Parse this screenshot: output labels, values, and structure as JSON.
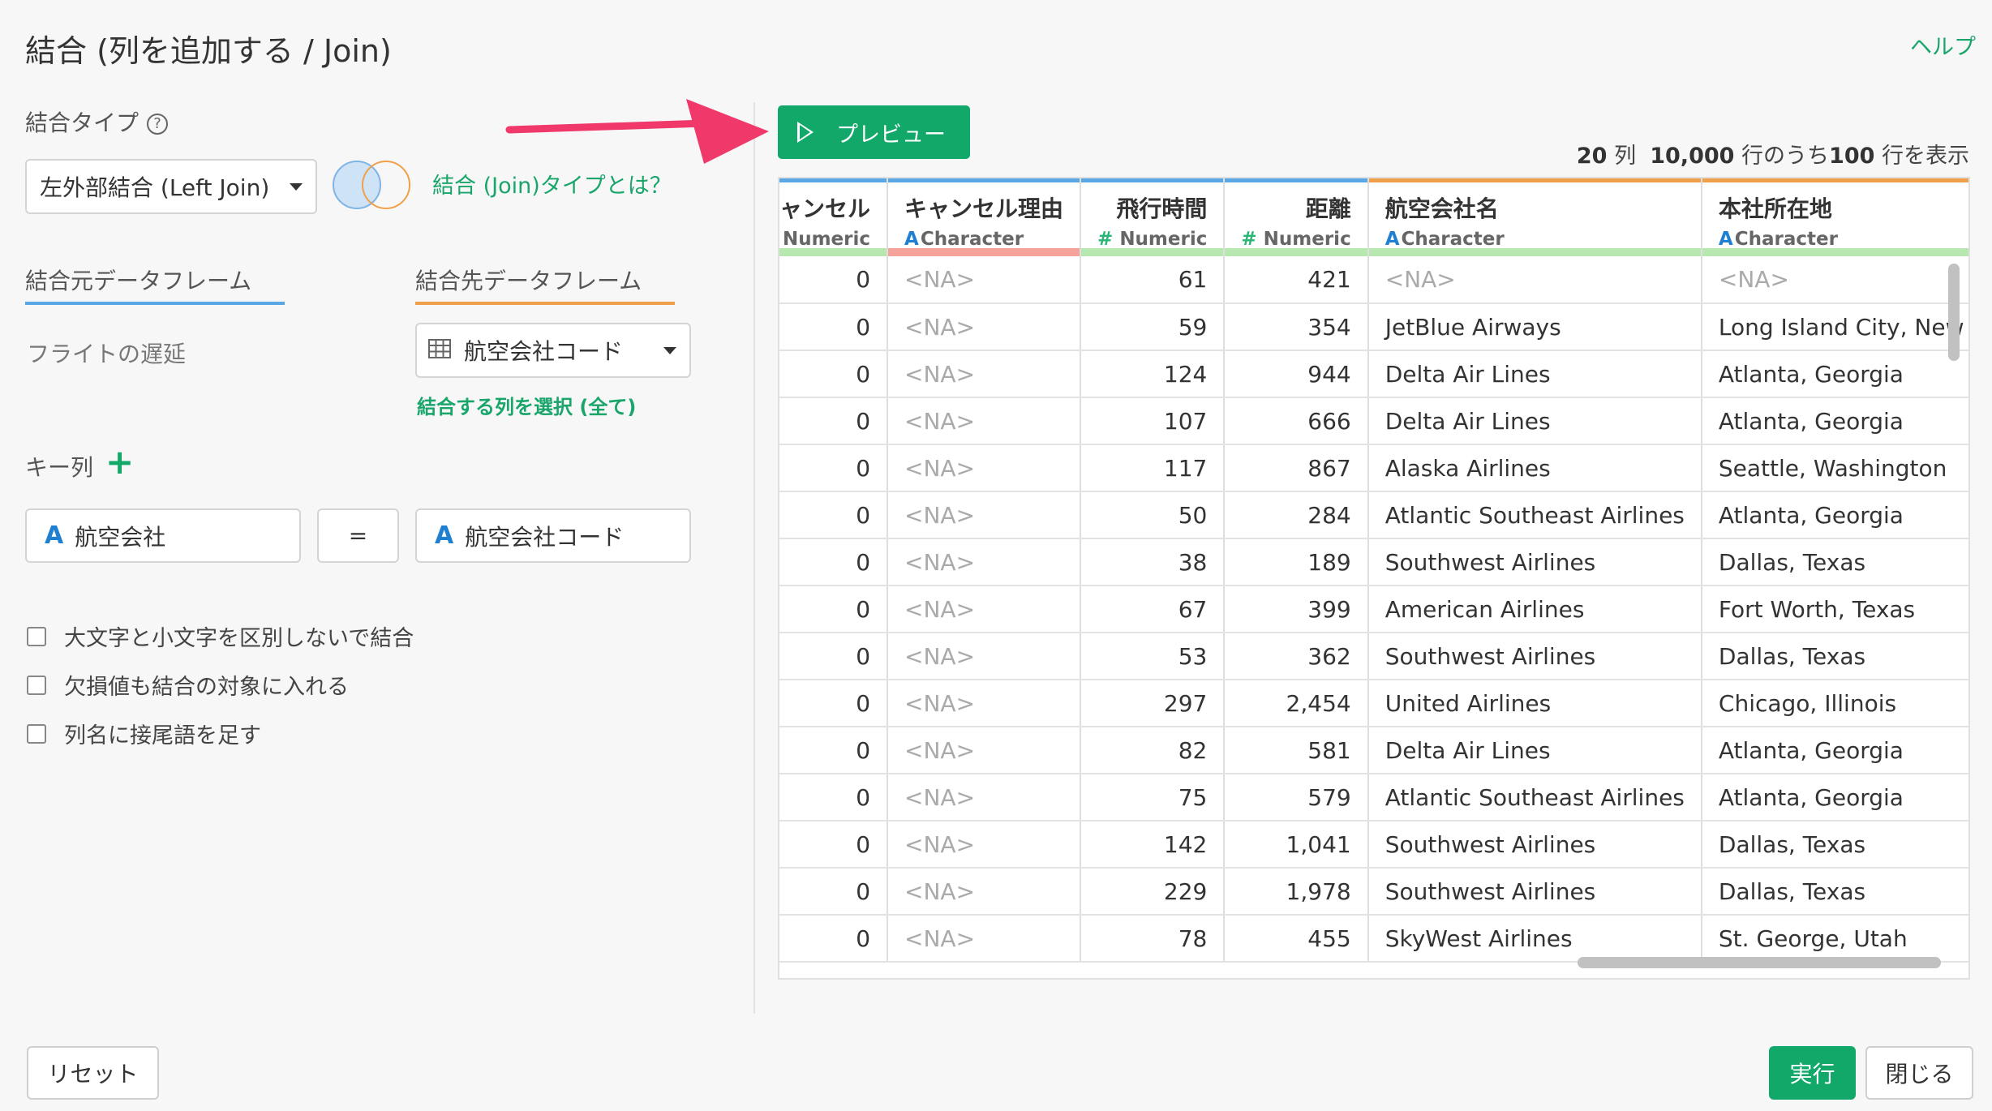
{
  "dialog": {
    "title": "結合 (列を追加する / Join)",
    "help_link": "ヘルプ"
  },
  "join_type": {
    "label": "結合タイプ",
    "help_glyph": "?",
    "selected": "左外部結合 (Left Join)",
    "info_link": "結合 (Join)タイプとは？"
  },
  "source": {
    "tab_label": "結合元データフレーム",
    "name": "フライトの遅延"
  },
  "target": {
    "tab_label": "結合先データフレーム",
    "selected": "航空会社コード",
    "select_columns_link": "結合する列を選択 (全て)"
  },
  "key_columns": {
    "label": "キー列",
    "add_glyph": "+",
    "left_type_glyph": "A",
    "left": "航空会社",
    "operator": "=",
    "right_type_glyph": "A",
    "right": "航空会社コード"
  },
  "options": [
    {
      "label": "大文字と小文字を区別しないで結合",
      "checked": false
    },
    {
      "label": "欠損値も結合の対象に入れる",
      "checked": false
    },
    {
      "label": "列名に接尾語を足す",
      "checked": false
    }
  ],
  "preview": {
    "button_label": "プレビュー",
    "cols_count": "20",
    "cols_suffix": "列",
    "total_rows": "10,000",
    "rows_mid": "行のうち",
    "shown_rows": "100",
    "rows_suffix": "行を表示"
  },
  "table": {
    "columns": [
      {
        "name": "キャンセル",
        "type_glyph": "#",
        "type": "Numeric",
        "top_color": "#5aa7e6",
        "bottom_color": "#b6e8b0"
      },
      {
        "name": "キャンセル理由",
        "type_glyph": "A",
        "type": "Character",
        "top_color": "#5aa7e6",
        "bottom_color": "#f4a29a"
      },
      {
        "name": "飛行時間",
        "type_glyph": "#",
        "type": "Numeric",
        "top_color": "#5aa7e6",
        "bottom_color": "#b6e8b0"
      },
      {
        "name": "距離",
        "type_glyph": "#",
        "type": "Numeric",
        "top_color": "#5aa7e6",
        "bottom_color": "#b6e8b0"
      },
      {
        "name": "航空会社名",
        "type_glyph": "A",
        "type": "Character",
        "top_color": "#f0a04b",
        "bottom_color": "#b6e8b0"
      },
      {
        "name": "本社所在地",
        "type_glyph": "A",
        "type": "Character",
        "top_color": "#f0a04b",
        "bottom_color": "#b6e8b0"
      }
    ],
    "rows": [
      [
        "0",
        "<NA>",
        "61",
        "421",
        "<NA>",
        "<NA>"
      ],
      [
        "0",
        "<NA>",
        "59",
        "354",
        "JetBlue Airways",
        "Long Island City, New York"
      ],
      [
        "0",
        "<NA>",
        "124",
        "944",
        "Delta Air Lines",
        "Atlanta, Georgia"
      ],
      [
        "0",
        "<NA>",
        "107",
        "666",
        "Delta Air Lines",
        "Atlanta, Georgia"
      ],
      [
        "0",
        "<NA>",
        "117",
        "867",
        "Alaska Airlines",
        "Seattle, Washington"
      ],
      [
        "0",
        "<NA>",
        "50",
        "284",
        "Atlantic Southeast Airlines",
        "Atlanta, Georgia"
      ],
      [
        "0",
        "<NA>",
        "38",
        "189",
        "Southwest Airlines",
        "Dallas, Texas"
      ],
      [
        "0",
        "<NA>",
        "67",
        "399",
        "American Airlines",
        "Fort Worth, Texas"
      ],
      [
        "0",
        "<NA>",
        "53",
        "362",
        "Southwest Airlines",
        "Dallas, Texas"
      ],
      [
        "0",
        "<NA>",
        "297",
        "2,454",
        "United Airlines",
        "Chicago, Illinois"
      ],
      [
        "0",
        "<NA>",
        "82",
        "581",
        "Delta Air Lines",
        "Atlanta, Georgia"
      ],
      [
        "0",
        "<NA>",
        "75",
        "579",
        "Atlantic Southeast Airlines",
        "Atlanta, Georgia"
      ],
      [
        "0",
        "<NA>",
        "142",
        "1,041",
        "Southwest Airlines",
        "Dallas, Texas"
      ],
      [
        "0",
        "<NA>",
        "229",
        "1,978",
        "Southwest Airlines",
        "Dallas, Texas"
      ],
      [
        "0",
        "<NA>",
        "78",
        "455",
        "SkyWest Airlines",
        "St. George, Utah"
      ]
    ]
  },
  "footer": {
    "reset_label": "リセット",
    "run_label": "実行",
    "close_label": "閉じる"
  },
  "colors": {
    "accent_green": "#11a86a",
    "arrow_pink": "#f0386b",
    "source_blue": "#5aa7e6",
    "target_orange": "#f0a04b"
  }
}
